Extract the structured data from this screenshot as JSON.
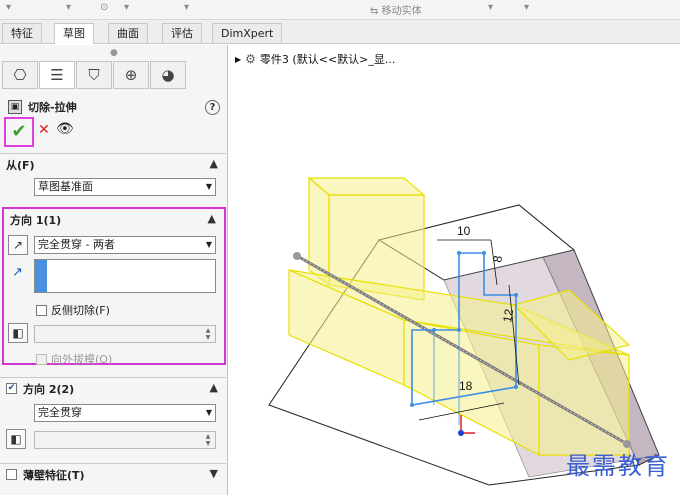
{
  "toolbar": {
    "move_entity_label": "移动实体"
  },
  "tabs": [
    {
      "label": "特征"
    },
    {
      "label": "草图"
    },
    {
      "label": "曲面"
    },
    {
      "label": "评估"
    },
    {
      "label": "DimXpert"
    }
  ],
  "active_tab": "草图",
  "view_tools": [
    "zoom-to-fit-icon",
    "zoom-area-icon",
    "previous-view-icon",
    "section-view-icon",
    "view-orientation-icon"
  ],
  "property_manager": {
    "panel_tabs": [
      "feature-manager-icon",
      "property-manager-icon",
      "configuration-manager-icon",
      "dimxpert-icon",
      "display-manager-icon"
    ],
    "feature_name": "切除-拉伸",
    "help_glyph": "?",
    "ok_glyph": "✔",
    "cancel_glyph": "✕",
    "preview_glyph": "👁",
    "from": {
      "label": "从(F)",
      "value": "草图基准面"
    },
    "direction1": {
      "label": "方向 1(1)",
      "end_condition": "完全贯穿 - 两者",
      "flip_side_label": "反侧切除(F)",
      "draft_outward_label": "向外拔模(O)"
    },
    "direction2": {
      "label": "方向 2(2)",
      "checked": true,
      "end_condition": "完全贯穿"
    },
    "thin_feature": {
      "label": "薄壁特征(T)",
      "checked": false
    }
  },
  "viewport": {
    "tree_label": "零件3  (默认<<默认>_显..."
  },
  "dimensions": [
    "10",
    "8",
    "12",
    "18"
  ],
  "watermark": "最需教育",
  "colors": {
    "highlight_magenta": "#d535d5",
    "ok_green": "#3aa02a",
    "cancel_red": "#d02020",
    "selection_blue": "#4a90e0",
    "preview_yellow": "#f4f08a",
    "sketch_blue": "#3c8ee6",
    "watermark_blue": "#3a5fd0"
  }
}
